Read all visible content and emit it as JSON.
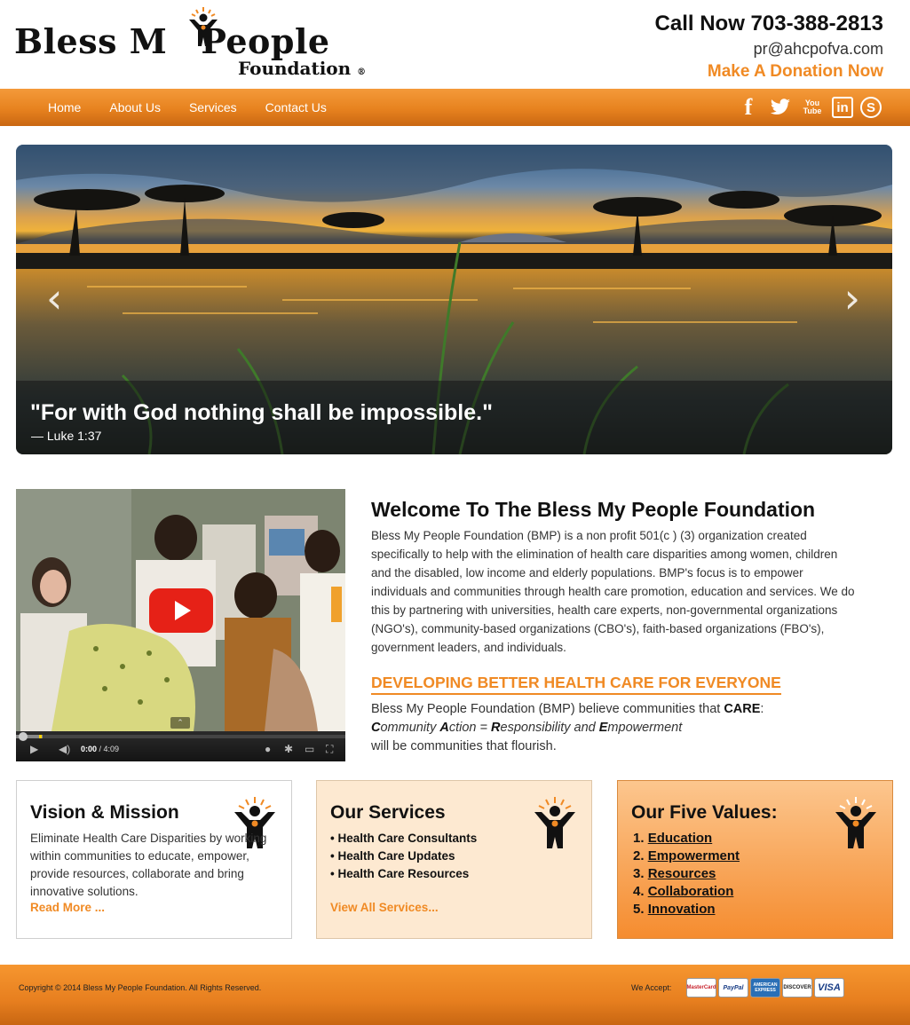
{
  "header": {
    "logo": {
      "line1": "Bless M",
      "line1b": "People",
      "line2": "Foundation",
      "registered": "®"
    },
    "phone": "Call Now 703-388-2813",
    "email": "pr@ahcpofva.com",
    "donate": "Make A Donation Now"
  },
  "nav": {
    "items": [
      {
        "label": "Home"
      },
      {
        "label": "About Us"
      },
      {
        "label": "Services"
      },
      {
        "label": "Contact Us"
      }
    ],
    "social": [
      "facebook-icon",
      "twitter-icon",
      "youtube-icon",
      "linkedin-icon",
      "skype-icon"
    ],
    "social_glyphs": {
      "facebook": "f",
      "youtube": "You Tube",
      "linkedin": "in",
      "skype": "S"
    }
  },
  "slider": {
    "quote": "\"For with God nothing shall be impossible.\"",
    "cite": "— Luke 1:37",
    "prev": "‹",
    "next": "›"
  },
  "video": {
    "time_current": "0:00",
    "time_total": "/ 4:09",
    "progress_fraction": 0.0
  },
  "welcome": {
    "title": "Welcome To The Bless My People Foundation",
    "intro": "Bless My People Foundation (BMP) is a non profit 501(c ) (3) organization created specifically to help with the elimination of health care disparities among women, children and the disabled, low income and elderly populations. BMP's focus is to empower individuals and communities through health care promotion, education and services. We do this by partnering with universities, health care experts, non-governmental organizations (NGO's), community-based organizations (CBO's), faith-based organizations (FBO's), government leaders, and individuals.",
    "subheading": "DEVELOPING BETTER HEALTH CARE FOR EVERYONE",
    "care_line1": "Bless My People Foundation (BMP) believe communities that",
    "care_word": "CARE",
    "care_colon": ":",
    "care_acronym": [
      {
        "letter": "C",
        "rest": "ommunity "
      },
      {
        "letter": "A",
        "rest": "ction = "
      },
      {
        "letter": "R",
        "rest": "esponsibility and "
      },
      {
        "letter": "E",
        "rest": "mpowerment"
      }
    ],
    "care_line3": "will be communities that flourish."
  },
  "boxes": {
    "vision": {
      "title": "Vision & Mission",
      "text": "Eliminate Health Care Disparities by working within communities to educate, empower, provide resources, collaborate and bring innovative solutions.",
      "link": "Read More ..."
    },
    "services": {
      "title": "Our Services",
      "items": [
        "• Health Care Consultants",
        "• Health Care Updates",
        "• Health Care Resources"
      ],
      "link": "View All Services..."
    },
    "values": {
      "title": "Our Five Values:",
      "items": [
        {
          "num": "1.",
          "label": "Education"
        },
        {
          "num": "2.",
          "label": "Empowerment"
        },
        {
          "num": "3.",
          "label": "Resources"
        },
        {
          "num": "4.",
          "label": "Collaboration"
        },
        {
          "num": "5.",
          "label": "Innovation"
        }
      ]
    }
  },
  "footer": {
    "copyright": "Copyright © 2014 Bless My People Foundation. All Rights Reserved.",
    "accept": "We Accept:",
    "cards": [
      "MasterCard",
      "PayPal",
      "AMERICAN EXPRESS",
      "DISCOVER",
      "VISA"
    ]
  },
  "colors": {
    "accent": "#f08a24",
    "nav": "#e7821f",
    "box_services": "#fde9d1",
    "box_values": "#f58c2f"
  }
}
